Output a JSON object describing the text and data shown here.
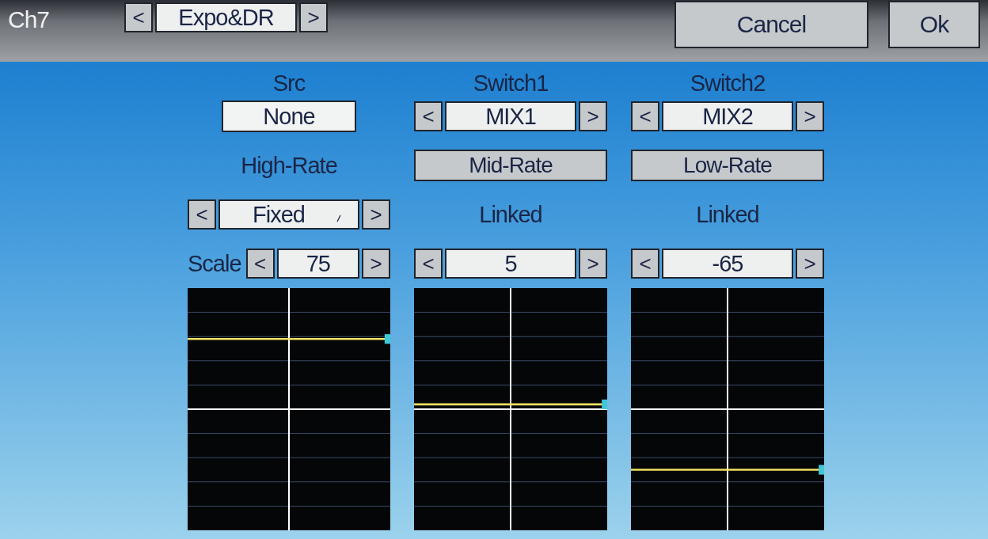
{
  "header": {
    "title": "Ch7",
    "page_selector": {
      "prev": "<",
      "value": "Expo&DR",
      "next": ">"
    }
  },
  "buttons": [
    {
      "label": "Cancel"
    },
    {
      "label": "Ok"
    }
  ],
  "columns": [
    {
      "header": "Src",
      "source": {
        "kind": "field",
        "value": "None"
      },
      "rate": {
        "kind": "label",
        "text": "High-Rate"
      },
      "mode": {
        "kind": "selector",
        "prev": "<",
        "value": "Fixed",
        "next": ">"
      },
      "value_label": "Scale",
      "value": {
        "prev": "<",
        "value": "75",
        "next": ">"
      },
      "curve": {
        "level": 0.79
      }
    },
    {
      "header": "Switch1",
      "source": {
        "kind": "selector",
        "prev": "<",
        "value": "MIX1",
        "next": ">"
      },
      "rate": {
        "kind": "button",
        "text": "Mid-Rate"
      },
      "mode": {
        "kind": "label",
        "text": "Linked"
      },
      "value": {
        "prev": "<",
        "value": "5",
        "next": ">"
      },
      "curve": {
        "level": 0.52
      }
    },
    {
      "header": "Switch2",
      "source": {
        "kind": "selector",
        "prev": "<",
        "value": "MIX2",
        "next": ">"
      },
      "rate": {
        "kind": "button",
        "text": "Low-Rate"
      },
      "mode": {
        "kind": "label",
        "text": "Linked"
      },
      "value": {
        "prev": "<",
        "value": "-65",
        "next": ">"
      },
      "curve": {
        "level": 0.25
      }
    }
  ]
}
